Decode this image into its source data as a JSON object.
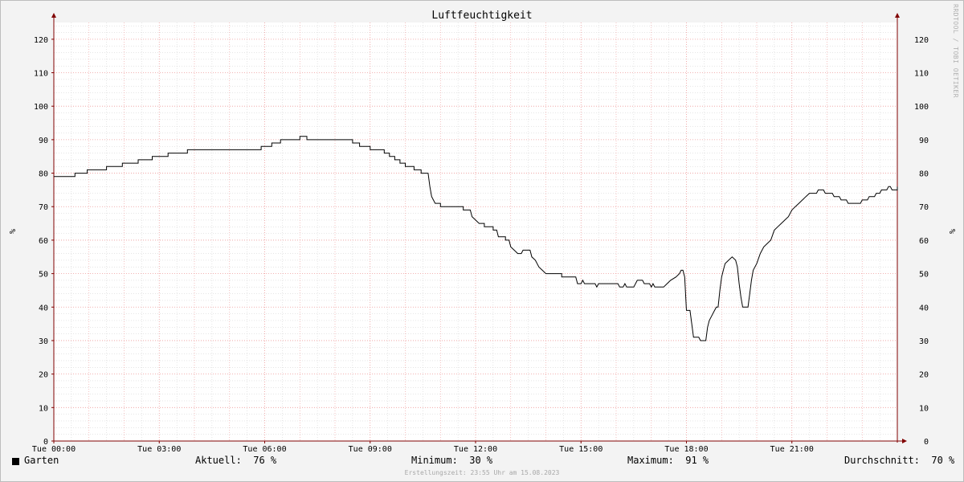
{
  "chart_data": {
    "type": "line",
    "title": "Luftfeuchtigkeit",
    "ylabel": "%",
    "ylim": [
      0,
      125
    ],
    "y_ticks": [
      0,
      10,
      20,
      30,
      40,
      50,
      60,
      70,
      80,
      90,
      100,
      110,
      120
    ],
    "x_ticks": [
      "Tue 00:00",
      "Tue 03:00",
      "Tue 06:00",
      "Tue 09:00",
      "Tue 12:00",
      "Tue 15:00",
      "Tue 18:00",
      "Tue 21:00"
    ],
    "x_range_hours": [
      0,
      24
    ],
    "grid": true,
    "series": [
      {
        "name": "Garten",
        "color": "#000000",
        "points": [
          [
            0.0,
            79
          ],
          [
            0.6,
            79
          ],
          [
            0.6,
            80
          ],
          [
            0.95,
            80
          ],
          [
            0.95,
            81
          ],
          [
            1.5,
            81
          ],
          [
            1.5,
            82
          ],
          [
            1.95,
            82
          ],
          [
            1.95,
            83
          ],
          [
            2.4,
            83
          ],
          [
            2.4,
            84
          ],
          [
            2.8,
            84
          ],
          [
            2.8,
            85
          ],
          [
            3.25,
            85
          ],
          [
            3.25,
            86
          ],
          [
            3.8,
            86
          ],
          [
            3.8,
            87
          ],
          [
            5.9,
            87
          ],
          [
            5.9,
            88
          ],
          [
            6.2,
            88
          ],
          [
            6.2,
            89
          ],
          [
            6.45,
            89
          ],
          [
            6.45,
            90
          ],
          [
            7.0,
            90
          ],
          [
            7.0,
            91
          ],
          [
            7.2,
            91
          ],
          [
            7.2,
            90
          ],
          [
            8.5,
            90
          ],
          [
            8.5,
            89
          ],
          [
            8.7,
            89
          ],
          [
            8.7,
            88
          ],
          [
            9.0,
            88
          ],
          [
            9.0,
            87
          ],
          [
            9.4,
            87
          ],
          [
            9.4,
            86
          ],
          [
            9.55,
            86
          ],
          [
            9.55,
            85
          ],
          [
            9.7,
            85
          ],
          [
            9.7,
            84
          ],
          [
            9.85,
            84
          ],
          [
            9.85,
            83
          ],
          [
            10.0,
            83
          ],
          [
            10.0,
            82
          ],
          [
            10.25,
            82
          ],
          [
            10.25,
            81
          ],
          [
            10.45,
            81
          ],
          [
            10.45,
            80
          ],
          [
            10.65,
            80
          ],
          [
            10.7,
            76
          ],
          [
            10.75,
            73
          ],
          [
            10.85,
            71
          ],
          [
            11.0,
            71
          ],
          [
            11.0,
            70
          ],
          [
            11.65,
            70
          ],
          [
            11.65,
            69
          ],
          [
            11.85,
            69
          ],
          [
            11.9,
            67
          ],
          [
            12.0,
            66
          ],
          [
            12.1,
            65
          ],
          [
            12.25,
            65
          ],
          [
            12.25,
            64
          ],
          [
            12.5,
            64
          ],
          [
            12.5,
            63
          ],
          [
            12.6,
            63
          ],
          [
            12.65,
            61
          ],
          [
            12.85,
            61
          ],
          [
            12.85,
            60
          ],
          [
            12.95,
            60
          ],
          [
            13.0,
            58
          ],
          [
            13.1,
            57
          ],
          [
            13.2,
            56
          ],
          [
            13.3,
            56
          ],
          [
            13.35,
            57
          ],
          [
            13.55,
            57
          ],
          [
            13.6,
            55
          ],
          [
            13.7,
            54
          ],
          [
            13.8,
            52
          ],
          [
            13.9,
            51
          ],
          [
            14.0,
            50
          ],
          [
            14.45,
            50
          ],
          [
            14.45,
            49
          ],
          [
            14.85,
            49
          ],
          [
            14.9,
            47
          ],
          [
            15.0,
            47
          ],
          [
            15.05,
            48
          ],
          [
            15.1,
            47
          ],
          [
            15.4,
            47
          ],
          [
            15.45,
            46
          ],
          [
            15.5,
            47
          ],
          [
            16.05,
            47
          ],
          [
            16.1,
            46
          ],
          [
            16.2,
            46
          ],
          [
            16.25,
            47
          ],
          [
            16.3,
            46
          ],
          [
            16.5,
            46
          ],
          [
            16.55,
            47
          ],
          [
            16.6,
            48
          ],
          [
            16.75,
            48
          ],
          [
            16.8,
            47
          ],
          [
            16.95,
            47
          ],
          [
            17.0,
            46
          ],
          [
            17.05,
            47
          ],
          [
            17.1,
            46
          ],
          [
            17.35,
            46
          ],
          [
            17.45,
            47
          ],
          [
            17.55,
            48
          ],
          [
            17.7,
            49
          ],
          [
            17.8,
            50
          ],
          [
            17.85,
            51
          ],
          [
            17.9,
            51
          ],
          [
            17.95,
            49
          ],
          [
            18.0,
            39
          ],
          [
            18.1,
            39
          ],
          [
            18.15,
            35
          ],
          [
            18.2,
            31
          ],
          [
            18.35,
            31
          ],
          [
            18.4,
            30
          ],
          [
            18.55,
            30
          ],
          [
            18.6,
            34
          ],
          [
            18.65,
            36
          ],
          [
            18.7,
            37
          ],
          [
            18.8,
            39
          ],
          [
            18.85,
            40
          ],
          [
            18.9,
            40
          ],
          [
            18.95,
            45
          ],
          [
            19.0,
            49
          ],
          [
            19.05,
            51
          ],
          [
            19.1,
            53
          ],
          [
            19.2,
            54
          ],
          [
            19.3,
            55
          ],
          [
            19.4,
            54
          ],
          [
            19.45,
            52
          ],
          [
            19.5,
            47
          ],
          [
            19.55,
            43
          ],
          [
            19.6,
            40
          ],
          [
            19.75,
            40
          ],
          [
            19.8,
            44
          ],
          [
            19.85,
            48
          ],
          [
            19.9,
            51
          ],
          [
            20.0,
            53
          ],
          [
            20.1,
            56
          ],
          [
            20.2,
            58
          ],
          [
            20.3,
            59
          ],
          [
            20.4,
            60
          ],
          [
            20.5,
            63
          ],
          [
            20.6,
            64
          ],
          [
            20.7,
            65
          ],
          [
            20.8,
            66
          ],
          [
            20.9,
            67
          ],
          [
            21.0,
            69
          ],
          [
            21.1,
            70
          ],
          [
            21.2,
            71
          ],
          [
            21.3,
            72
          ],
          [
            21.4,
            73
          ],
          [
            21.5,
            74
          ],
          [
            21.7,
            74
          ],
          [
            21.75,
            75
          ],
          [
            21.9,
            75
          ],
          [
            21.95,
            74
          ],
          [
            22.15,
            74
          ],
          [
            22.2,
            73
          ],
          [
            22.35,
            73
          ],
          [
            22.4,
            72
          ],
          [
            22.55,
            72
          ],
          [
            22.6,
            71
          ],
          [
            22.95,
            71
          ],
          [
            23.0,
            72
          ],
          [
            23.15,
            72
          ],
          [
            23.2,
            73
          ],
          [
            23.35,
            73
          ],
          [
            23.4,
            74
          ],
          [
            23.5,
            74
          ],
          [
            23.55,
            75
          ],
          [
            23.7,
            75
          ],
          [
            23.75,
            76
          ],
          [
            23.8,
            76
          ],
          [
            23.85,
            75
          ],
          [
            24.0,
            75
          ],
          [
            24.0,
            76
          ],
          [
            24.25,
            76
          ]
        ]
      }
    ]
  },
  "legend": {
    "series_label": "Garten",
    "current": "Aktuell:  76 %",
    "minimum": "Minimum:  30 %",
    "maximum": "Maximum:  91 %",
    "average": "Durchschnitt:  70 %"
  },
  "footer": "Erstellungszeit: 23:55 Uhr am 15.08.2023",
  "watermark": "RRDTOOL / TOBI OETIKER",
  "colors": {
    "background": "#f3f3f3",
    "plot_background": "#ffffff",
    "major_grid": "#ee9999",
    "minor_grid": "#cccccc",
    "axis": "#800000",
    "line": "#000000"
  }
}
